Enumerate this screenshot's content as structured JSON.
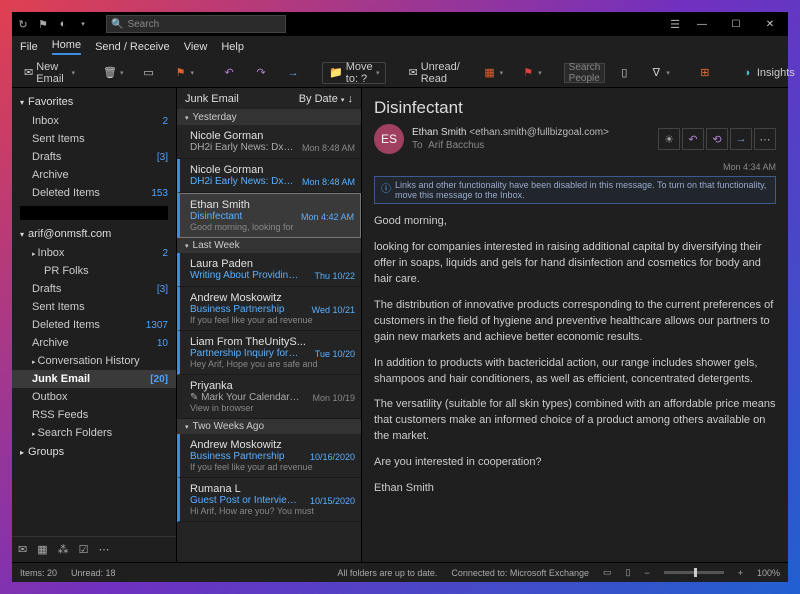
{
  "titlebar": {
    "search_placeholder": "Search"
  },
  "menus": {
    "file": "File",
    "home": "Home",
    "send_receive": "Send / Receive",
    "view": "View",
    "help": "Help"
  },
  "ribbon": {
    "new_email": "New Email",
    "move_to": "Move to: ?",
    "unread_read": "Unread/ Read",
    "search_people": "Search People",
    "insights": "Insights"
  },
  "nav": {
    "favorites_label": "Favorites",
    "favorites": [
      {
        "label": "Inbox",
        "count": "2"
      },
      {
        "label": "Sent Items"
      },
      {
        "label": "Drafts",
        "count": "[3]"
      },
      {
        "label": "Archive"
      },
      {
        "label": "Deleted Items",
        "count": "153"
      }
    ],
    "account_label": "arif@onmsft.com",
    "account": [
      {
        "label": "Inbox",
        "count": "2",
        "expandable": true
      },
      {
        "label": "PR Folks",
        "indent": true
      },
      {
        "label": "Drafts",
        "count": "[3]"
      },
      {
        "label": "Sent Items"
      },
      {
        "label": "Deleted Items",
        "count": "1307"
      },
      {
        "label": "Archive",
        "count": "10"
      },
      {
        "label": "Conversation History",
        "expandable": true
      },
      {
        "label": "Junk Email",
        "count": "[20]",
        "selected": true
      },
      {
        "label": "Outbox"
      },
      {
        "label": "RSS Feeds"
      },
      {
        "label": "Search Folders",
        "expandable": true
      }
    ],
    "groups_label": "Groups"
  },
  "list": {
    "folder": "Junk Email",
    "sort": "By Date",
    "groups": [
      {
        "label": "Yesterday",
        "messages": [
          {
            "from": "Nicole Gorman",
            "subject": "DH2i Early News: DxOdyssey f...",
            "preview": "",
            "date": "Mon 8:48 AM",
            "unread": false,
            "read_style": true
          },
          {
            "from": "Nicole Gorman",
            "subject": "DH2i Early News: DxOdysse...",
            "preview": "",
            "date": "Mon 8:48 AM",
            "unread": true
          },
          {
            "from": "Ethan Smith",
            "subject": "Disinfectant",
            "preview": "Good morning,  looking for",
            "date": "Mon 4:42 AM",
            "unread": true,
            "selected": true
          }
        ]
      },
      {
        "label": "Last Week",
        "messages": [
          {
            "from": "Laura Paden",
            "subject": "Writing About Providing To...",
            "preview": "",
            "date": "Thu 10/22",
            "unread": true
          },
          {
            "from": "Andrew Moskowitz",
            "subject": "Business Partnership",
            "preview": "If you feel like your ad revenue",
            "date": "Wed 10/21",
            "unread": true
          },
          {
            "from": "Liam From TheUnityS...",
            "subject": "Partnership Inquiry for Arif.",
            "preview": "Hey Arif,  Hope you are safe and",
            "date": "Tue 10/20",
            "unread": true
          },
          {
            "from": "Priyanka",
            "subject": "✎ Mark Your Calendars to M...",
            "preview": "View in browser",
            "date": "Mon 10/19",
            "unread": false,
            "read_style": true
          }
        ]
      },
      {
        "label": "Two Weeks Ago",
        "messages": [
          {
            "from": "Andrew Moskowitz",
            "subject": "Business Partnership",
            "preview": "If you feel like your ad revenue",
            "date": "10/16/2020",
            "unread": true
          },
          {
            "from": "Rumana L",
            "subject": "Guest Post or Interview opp...",
            "preview": "Hi Arif,  How are you?  You must",
            "date": "10/15/2020",
            "unread": true
          }
        ]
      }
    ]
  },
  "reading": {
    "subject": "Disinfectant",
    "avatar": "ES",
    "from_name": "Ethan Smith",
    "from_addr": "<ethan.smith@fullbizgoal.com>",
    "to_label": "To",
    "to_value": "Arif Bacchus",
    "date": "Mon 4:34 AM",
    "info": "Links and other functionality have been disabled in this message. To turn on that functionality, move this message to the Inbox.",
    "paragraphs": [
      "Good morning,",
      "looking for companies interested in raising additional capital by diversifying their offer in soaps, liquids and gels for hand disinfection and cosmetics for body and hair care.",
      "The distribution of innovative products corresponding to the current preferences of customers in the field of hygiene and preventive healthcare allows our partners to gain new markets and achieve better economic results.",
      "In addition to products with bactericidal action, our range includes shower gels, shampoos and hair conditioners, as well as efficient, concentrated detergents.",
      "The versatility (suitable for all skin types) combined with an affordable price means that customers make an informed choice of a product among others available on the market.",
      "Are you interested in cooperation?",
      "Ethan Smith"
    ]
  },
  "status": {
    "items": "Items: 20",
    "unread": "Unread: 18",
    "sync": "All folders are up to date.",
    "connected": "Connected to: Microsoft Exchange",
    "zoom": "100%"
  }
}
